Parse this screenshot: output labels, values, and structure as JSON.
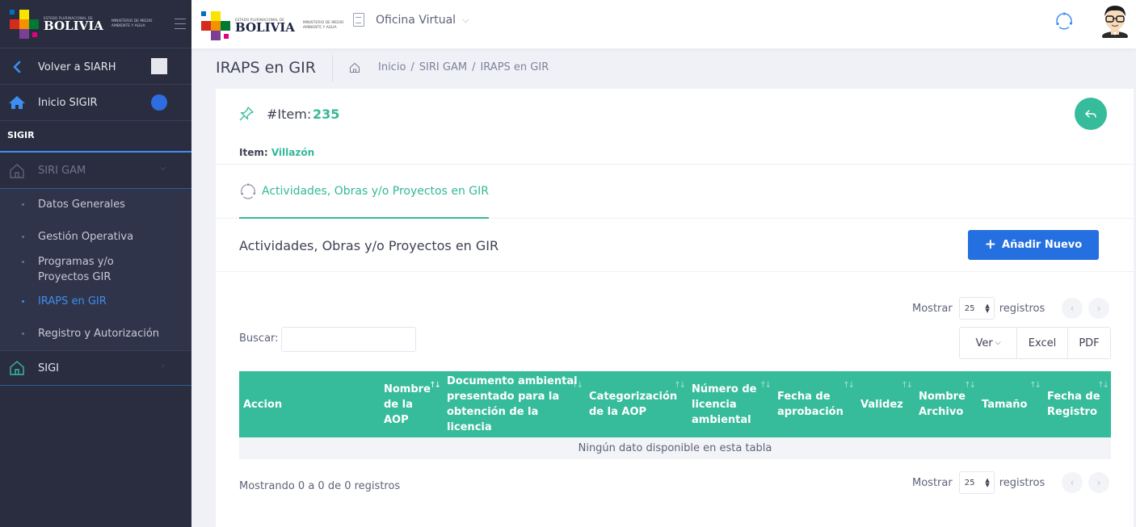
{
  "brand": {
    "top_small": "ESTADO PLURINACIONAL DE",
    "name": "BOLIVIA",
    "ministry": "MINISTERIO DE MEDIO AMBIENTE Y AGUA"
  },
  "sidebar": {
    "back_label": "Volver a SIARH",
    "home_label": "Inicio SIGIR",
    "section_label": "SIGIR",
    "group_label": "SIRI GAM",
    "sub_items": [
      {
        "label": "Datos Generales"
      },
      {
        "label": "Gestión Operativa"
      },
      {
        "label": "Programas y/o Proyectos GIR"
      },
      {
        "label": "IRAPS en GIR"
      },
      {
        "label": "Registro y Autorización"
      }
    ],
    "sigi_label": "SIGI"
  },
  "topbar": {
    "nav_label": "Oficina Virtual"
  },
  "subheader": {
    "title": "IRAPS en GIR",
    "crumbs": [
      "Inicio",
      "SIRI GAM",
      "IRAPS en GIR"
    ]
  },
  "card": {
    "item_label": "#Item:",
    "item_number": "235",
    "item_name_label": "Item:",
    "item_name_value": "Villazón",
    "tab_label": "Actividades, Obras y/o Proyectos en GIR",
    "section_title": "Actividades, Obras y/o Proyectos en GIR",
    "add_button": "Añadir Nuevo",
    "show_label": "Mostrar",
    "show_value": "25",
    "records_label": "registros",
    "search_label": "Buscar:",
    "search_value": "",
    "buttons": {
      "ver": "Ver",
      "excel": "Excel",
      "pdf": "PDF"
    },
    "table": {
      "columns": [
        "Accion",
        "Nombre de la AOP",
        "Documento ambiental presentado para la obtención de la licencia",
        "Categorización de la AOP",
        "Número de licencia ambiental",
        "Fecha de aprobación",
        "Validez",
        "Nombre Archivo",
        "Tamaño",
        "Fecha de Registro"
      ],
      "empty_message": "Ningún dato disponible en esta tabla"
    },
    "info": "Mostrando 0 a 0 de 0 registros"
  },
  "colors": {
    "accent_green": "#36bc9b",
    "primary_blue": "#2570e0",
    "sidebar_bg": "#2a2d3f",
    "active_link": "#3d8ef0"
  }
}
